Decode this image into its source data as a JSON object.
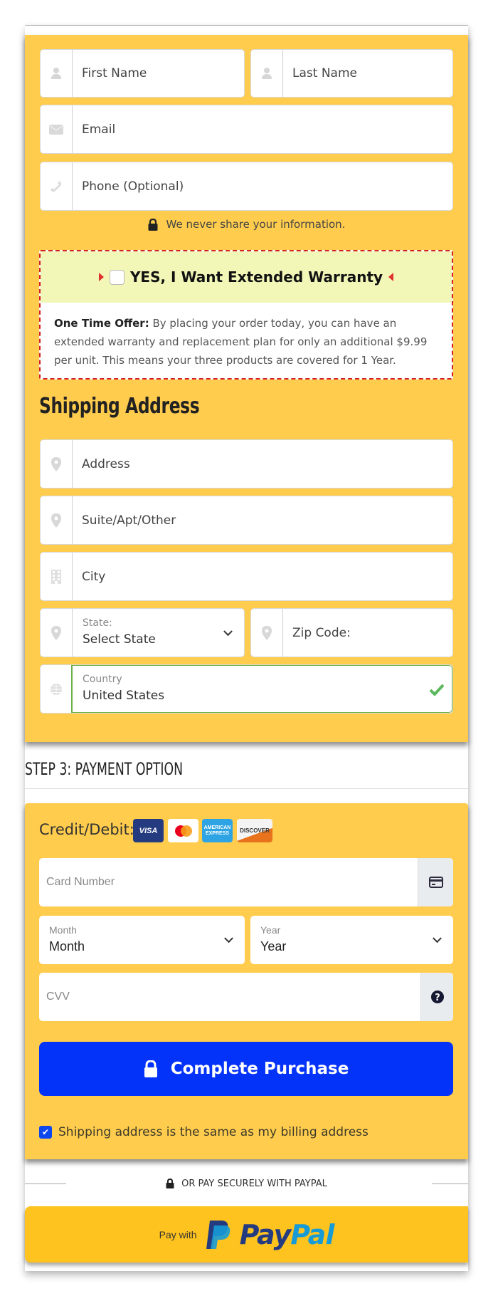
{
  "contact": {
    "first_name_placeholder": "First Name",
    "last_name_placeholder": "Last Name",
    "email_placeholder": "Email",
    "phone_placeholder": "Phone (Optional)",
    "privacy_note": "We never share your information."
  },
  "warranty": {
    "title": "YES, I Want Extended Warranty",
    "checked": false,
    "offer_label": "One Time Offer:",
    "offer_text": " By placing your order today, you can have an extended warranty and replacement plan for only an additional $9.99 per unit. This means your three products are covered for 1 Year."
  },
  "shipping": {
    "heading": "Shipping Address",
    "address_placeholder": "Address",
    "suite_placeholder": "Suite/Apt/Other",
    "city_placeholder": "City",
    "state_label": "State:",
    "state_value": "Select State",
    "zip_placeholder": "Zip Code:",
    "country_label": "Country",
    "country_value": "United States"
  },
  "payment": {
    "step_title": "STEP 3: PAYMENT OPTION",
    "credit_label": "Credit/Debit:",
    "card_logos": [
      "VISA",
      "Mastercard",
      "AMERICAN EXPRESS",
      "DISCOVER"
    ],
    "card_number_placeholder": "Card Number",
    "month_label": "Month",
    "month_value": "Month",
    "year_label": "Year",
    "year_value": "Year",
    "cvv_placeholder": "CVV",
    "submit_label": "Complete Purchase",
    "same_address_label": "Shipping address is the same as my billing address",
    "same_address_checked": true
  },
  "paypal": {
    "divider_text": "OR PAY SECURELY WITH PAYPAL",
    "pay_with": "Pay with",
    "brand_pay": "Pay",
    "brand_pal": "Pal"
  },
  "colors": {
    "panel": "#ffcc4d",
    "primary_button": "#0332f9",
    "paypal_button": "#ffc31f",
    "warranty_border": "#d32020",
    "valid_green": "#5cb85c"
  }
}
